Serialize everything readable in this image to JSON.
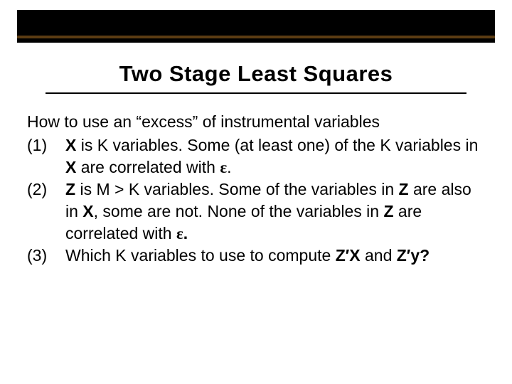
{
  "title": "Two Stage Least Squares",
  "intro": "How to use an “excess” of instrumental variables",
  "items": [
    {
      "num": "(1)",
      "pre": "",
      "b1": "X",
      "mid1": " is K variables.  Some (at least one) of the K variables in ",
      "b2": "X",
      "mid2": " are correlated with ",
      "eps": "ε",
      "post": "."
    },
    {
      "num": "(2)",
      "pre": "",
      "b1": "Z",
      "mid1": " is M > K variables.  Some of the variables in ",
      "b2": "Z",
      "mid2": " are also in ",
      "b3": "X",
      "mid3": ", some are not.  None of the variables in ",
      "b4": "Z",
      "mid4": " are correlated with ",
      "eps": "ε",
      "post": "."
    },
    {
      "num": "(3)",
      "pre": "Which K variables to use to compute ",
      "b1": "Z′X",
      "mid1": " and ",
      "b2": "Z′y?",
      "post": ""
    }
  ]
}
